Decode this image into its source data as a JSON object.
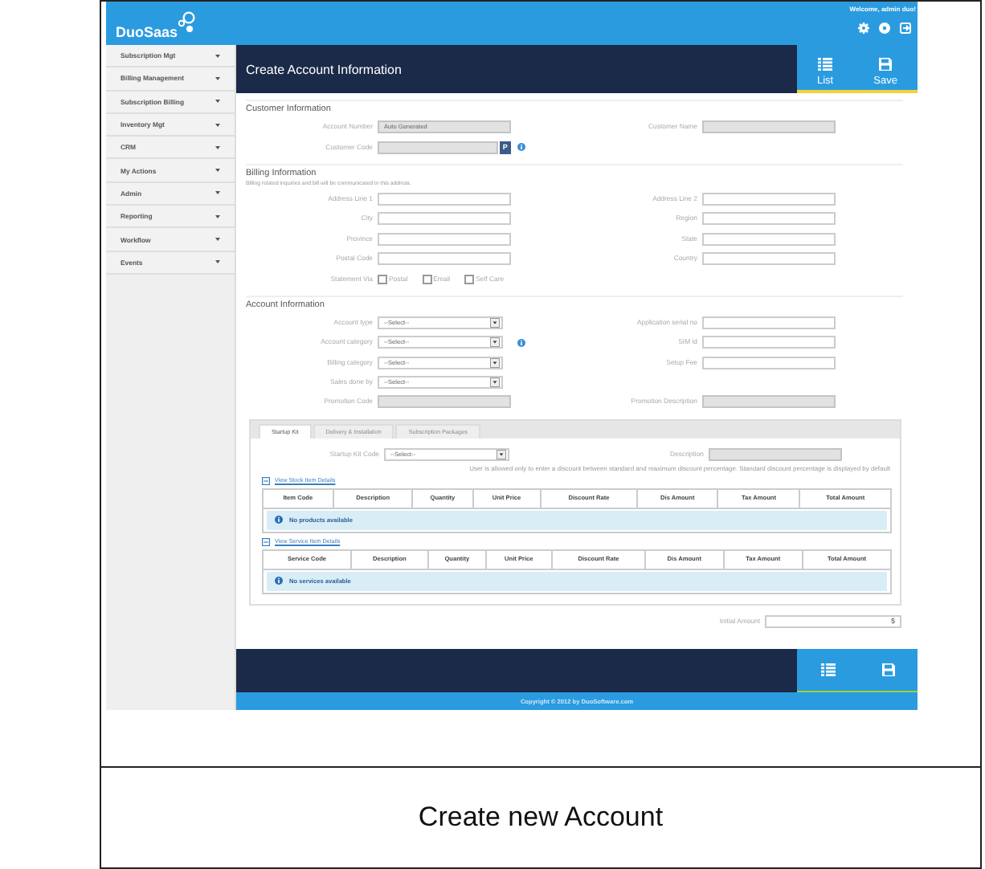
{
  "caption": "Create new Account",
  "app": {
    "brand": "DuoSaas",
    "welcome": "Welcome, admin duo!",
    "top_icons": [
      {
        "kind": "settings"
      },
      {
        "kind": "help"
      },
      {
        "kind": "logout"
      }
    ],
    "sidebar": {
      "items": [
        {
          "label": "Subscription Mgt"
        },
        {
          "label": "Billing Management"
        },
        {
          "label": "Subscription Billing"
        },
        {
          "label": "Inventory Mgt"
        },
        {
          "label": "CRM"
        },
        {
          "label": "My Actions"
        },
        {
          "label": "Admin"
        },
        {
          "label": "Reporting"
        },
        {
          "label": "Workflow"
        },
        {
          "label": "Events"
        }
      ]
    },
    "page_title": "Create Account Information",
    "header_actions": [
      {
        "kind": "list",
        "label": "List"
      },
      {
        "kind": "save",
        "label": "Save"
      }
    ],
    "sections": [
      {
        "heading": "Customer Information",
        "rows": [
          {
            "left": {
              "label": "Account Number",
              "kind": "text",
              "value": "Auto Generated",
              "disabled": true
            },
            "right": {
              "label": "Customer Name",
              "kind": "text",
              "disabled": true
            }
          },
          {
            "left": {
              "label": "Customer Code",
              "kind": "text",
              "disabled": true,
              "button": "P",
              "info": true
            }
          }
        ]
      },
      {
        "heading": "Billing Information",
        "note": "Billing related inquiries and bill will be communicated to this address.",
        "rows": [
          {
            "left": {
              "label": "Address Line 1",
              "kind": "text",
              "disabled": false
            },
            "right": {
              "label": "Address Line 2",
              "kind": "text",
              "disabled": false
            }
          },
          {
            "left": {
              "label": "City",
              "kind": "text",
              "disabled": false
            },
            "right": {
              "label": "Region",
              "kind": "text",
              "disabled": false
            }
          },
          {
            "left": {
              "label": "Province",
              "kind": "text",
              "disabled": false
            },
            "right": {
              "label": "State",
              "kind": "text",
              "disabled": false
            }
          },
          {
            "left": {
              "label": "Postal Code",
              "kind": "text",
              "disabled": false
            },
            "right": {
              "label": "Country",
              "kind": "text",
              "disabled": false
            }
          },
          {
            "left": {
              "label": "Statement Via",
              "kind": "checks",
              "options": [
                {
                  "label": "Postal",
                  "checked": false
                },
                {
                  "label": "Email",
                  "checked": false
                },
                {
                  "label": "Self Care",
                  "checked": false
                }
              ]
            }
          }
        ]
      },
      {
        "heading": "Account Information",
        "rows": [
          {
            "left": {
              "label": "Account type",
              "kind": "select",
              "value": "--Select--"
            },
            "right": {
              "label": "Application serial no",
              "kind": "text",
              "disabled": false
            }
          },
          {
            "left": {
              "label": "Account category",
              "kind": "select",
              "value": "--Select--",
              "info": true
            },
            "right": {
              "label": "SIM id",
              "kind": "text",
              "disabled": false
            }
          },
          {
            "left": {
              "label": "Billing category",
              "kind": "select",
              "value": "--Select--"
            },
            "right": {
              "label": "Setup Fee",
              "kind": "text",
              "disabled": false
            }
          },
          {
            "left": {
              "label": "Sales done by",
              "kind": "select",
              "value": "--Select--"
            }
          },
          {
            "left": {
              "label": "Promotion Code",
              "kind": "text",
              "disabled": true
            },
            "right": {
              "label": "Promotion Description",
              "kind": "text",
              "disabled": true
            }
          }
        ]
      }
    ],
    "tabs": [
      {
        "label": "Startup Kit",
        "selected": true
      },
      {
        "label": "Delivery & Installation",
        "selected": false
      },
      {
        "label": "Subscription Packages",
        "selected": false
      }
    ],
    "tab_panel": {
      "rows": [
        {
          "left": {
            "label": "Startup Kit Code",
            "kind": "select",
            "value": "--Select--"
          },
          "right": {
            "label": "Description",
            "kind": "text",
            "disabled": true
          }
        }
      ],
      "note": "User is allowed only to enter a discount between standard and maximum discount percentage. Standard discount percentage is displayed by default",
      "tables": [
        {
          "link": "View Stock Item Details",
          "expanded": true,
          "columns": [
            "Item Code",
            "Description",
            "Quantity",
            "Unit Price",
            "Discount Rate",
            "Dis Amount",
            "Tax Amount",
            "Total Amount"
          ],
          "message": "No products available"
        },
        {
          "link": "View Service Item Details",
          "expanded": true,
          "columns": [
            "Service Code",
            "Description",
            "Quantity",
            "Unit Price",
            "Discount Rate",
            "Dis Amount",
            "Tax Amount",
            "Total Amount"
          ],
          "message": "No services available"
        }
      ]
    },
    "initial_amount": {
      "label": "Initial Amount",
      "suffix": "$"
    },
    "footer_actions": [
      {
        "kind": "list"
      },
      {
        "kind": "save"
      }
    ],
    "copyright": "Copyright © 2012 by DuoSoftware.com"
  }
}
